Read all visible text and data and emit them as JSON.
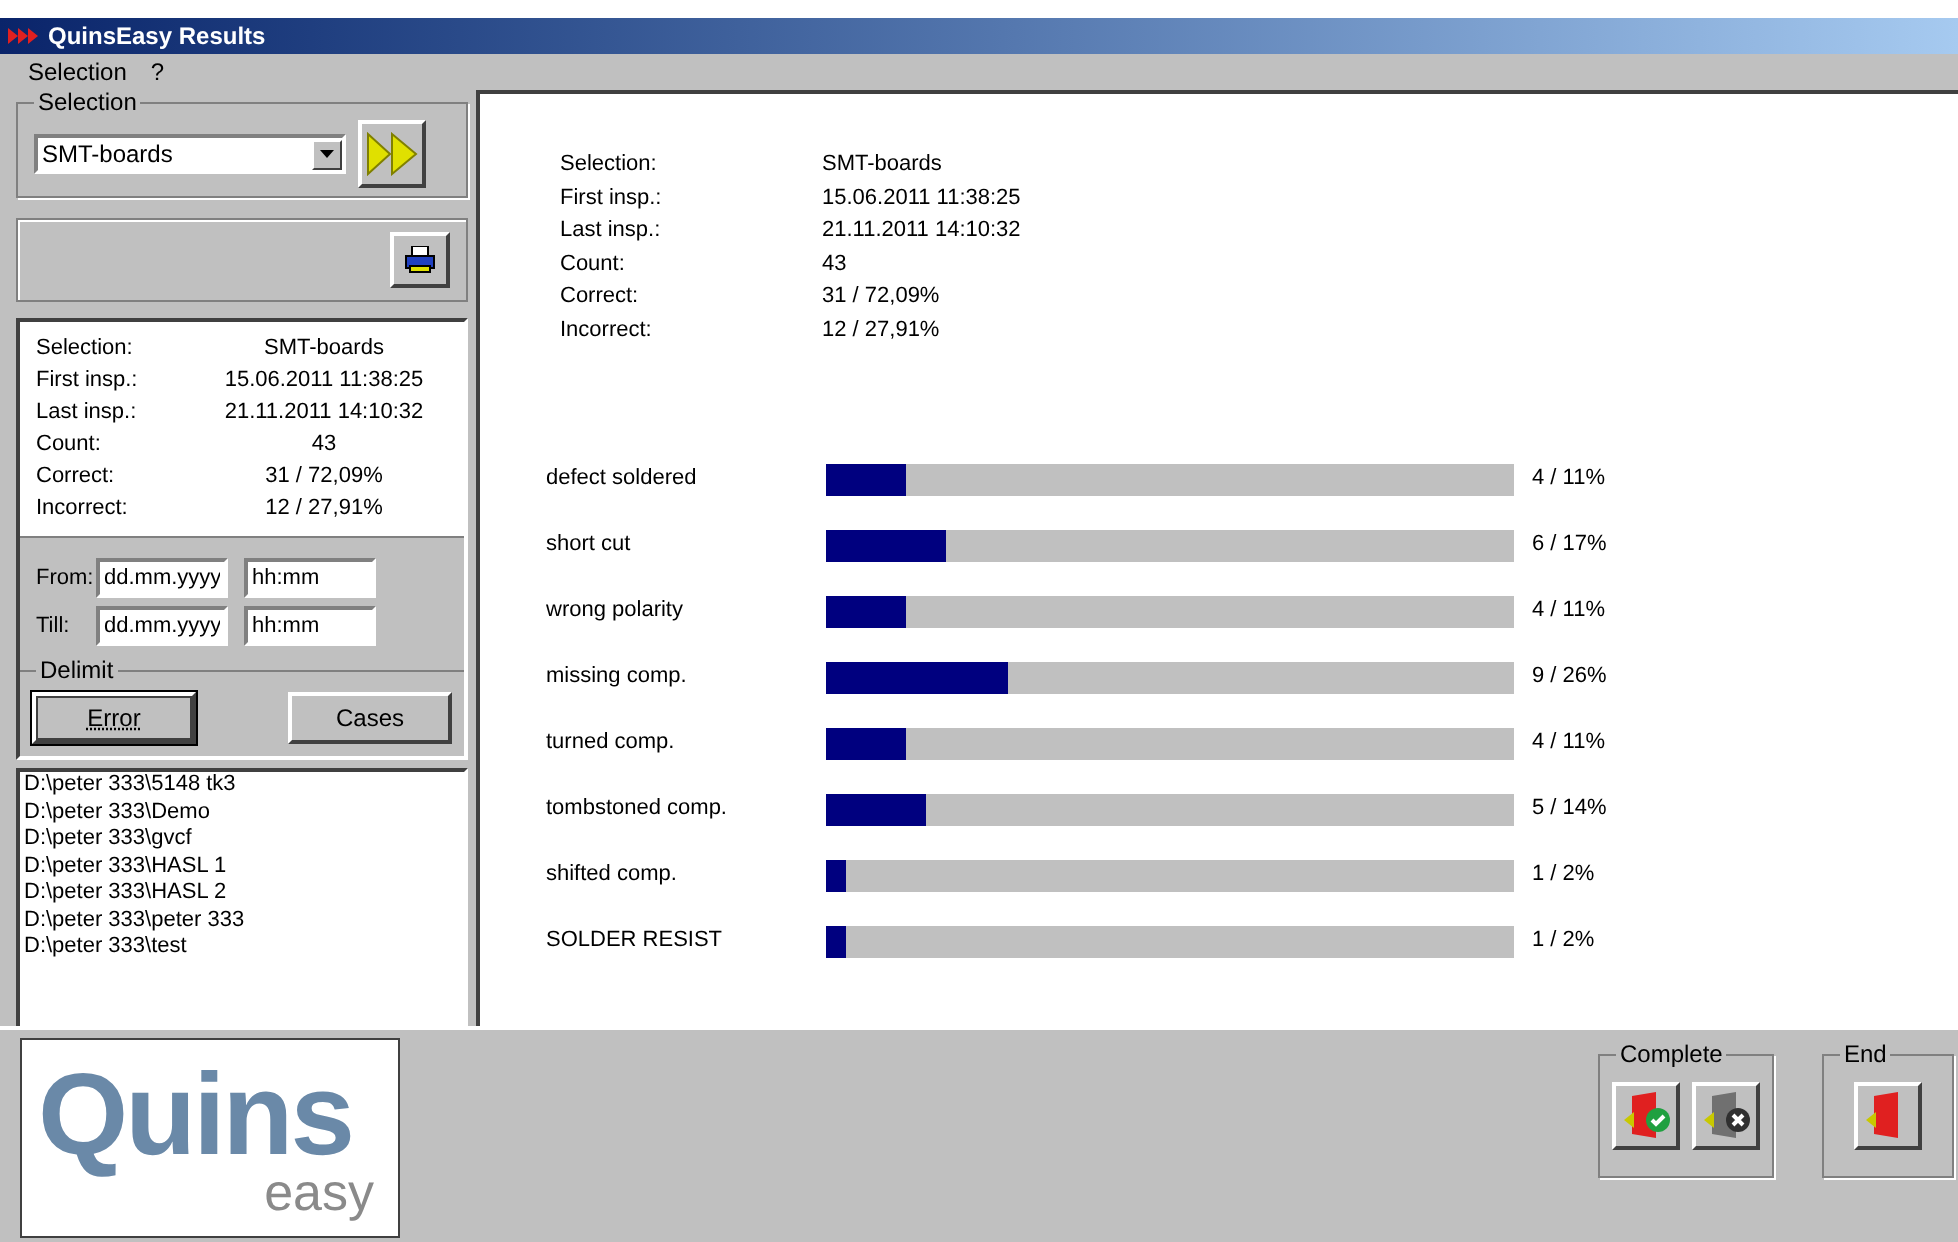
{
  "window": {
    "title": "QuinsEasy Results"
  },
  "menu": [
    "Selection",
    "?"
  ],
  "selection_group": {
    "legend": "Selection",
    "value": "SMT-boards"
  },
  "summary": [
    {
      "label": "Selection:",
      "value": "SMT-boards"
    },
    {
      "label": "First insp.:",
      "value": "15.06.2011 11:38:25"
    },
    {
      "label": "Last insp.:",
      "value": "21.11.2011 14:10:32"
    },
    {
      "label": "Count:",
      "value": "43"
    },
    {
      "label": "Correct:",
      "value": "31 / 72,09%"
    },
    {
      "label": "Incorrect:",
      "value": "12 / 27,91%"
    }
  ],
  "report_summary": [
    {
      "label": "Selection:",
      "value": "SMT-boards"
    },
    {
      "label": "First insp.:",
      "value": "15.06.2011 11:38:25"
    },
    {
      "label": "Last insp.:",
      "value": "21.11.2011 14:10:32"
    },
    {
      "label": "Count:",
      "value": "43"
    },
    {
      "label": "Correct:",
      "value": "31 / 72,09%"
    },
    {
      "label": "Incorrect:",
      "value": "12 / 27,91%"
    }
  ],
  "range": [
    {
      "label": "From:",
      "date_placeholder": "dd.mm.yyyy",
      "time_placeholder": "hh:mm"
    },
    {
      "label": "Till:",
      "date_placeholder": "dd.mm.yyyy",
      "time_placeholder": "hh:mm"
    }
  ],
  "delimit": {
    "legend": "Delimit",
    "buttons": [
      {
        "label": "Error",
        "selected": true
      },
      {
        "label": "Cases",
        "selected": false
      }
    ]
  },
  "folders": [
    "D:\\peter 333\\5148 tk3",
    "D:\\peter 333\\Demo",
    "D:\\peter 333\\gvcf",
    "D:\\peter 333\\HASL 1",
    "D:\\peter 333\\HASL 2",
    "D:\\peter 333\\peter 333",
    "D:\\peter 333\\test"
  ],
  "errors": [
    {
      "name": "defect soldered",
      "level": 0.115,
      "reading": "4 / 11%"
    },
    {
      "name": "short cut",
      "level": 0.175,
      "reading": "6 / 17%"
    },
    {
      "name": "wrong polarity",
      "level": 0.115,
      "reading": "4 / 11%"
    },
    {
      "name": "missing comp.",
      "level": 0.265,
      "reading": "9 / 26%"
    },
    {
      "name": "turned comp.",
      "level": 0.115,
      "reading": "4 / 11%"
    },
    {
      "name": "tombstoned comp.",
      "level": 0.145,
      "reading": "5 / 14%"
    },
    {
      "name": "shifted comp.",
      "level": 0.03,
      "reading": "1 / 2%"
    },
    {
      "name": "SOLDER RESIST",
      "level": 0.03,
      "reading": "1 / 2%"
    }
  ],
  "logo": {
    "main": "Quins",
    "sub": "easy"
  },
  "complete_group": {
    "legend": "Complete"
  },
  "end_group": {
    "legend": "End"
  }
}
